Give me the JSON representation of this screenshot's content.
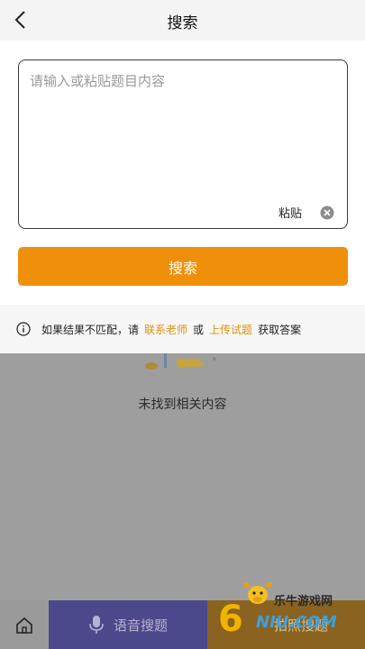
{
  "header": {
    "title": "搜索"
  },
  "search": {
    "placeholder": "请输入或粘贴题目内容",
    "value": "",
    "paste_label": "粘贴",
    "button_label": "搜索"
  },
  "hint": {
    "prefix": "如果结果不匹配，请",
    "link_teacher": "联系老师",
    "or": "或",
    "link_upload": "上传试题",
    "suffix": "获取答案"
  },
  "empty_state": {
    "message": "未找到相关内容"
  },
  "bottom_bar": {
    "voice_label": "语音搜题",
    "photo_label": "拍照搜题"
  },
  "watermark": {
    "cn": "乐牛游戏网",
    "digit": "6",
    "en": "NIU.COM"
  },
  "colors": {
    "accent": "#f0900a",
    "link": "#e0900a",
    "voice_bg": "#4c488c",
    "photo_bg": "#8a6320"
  }
}
